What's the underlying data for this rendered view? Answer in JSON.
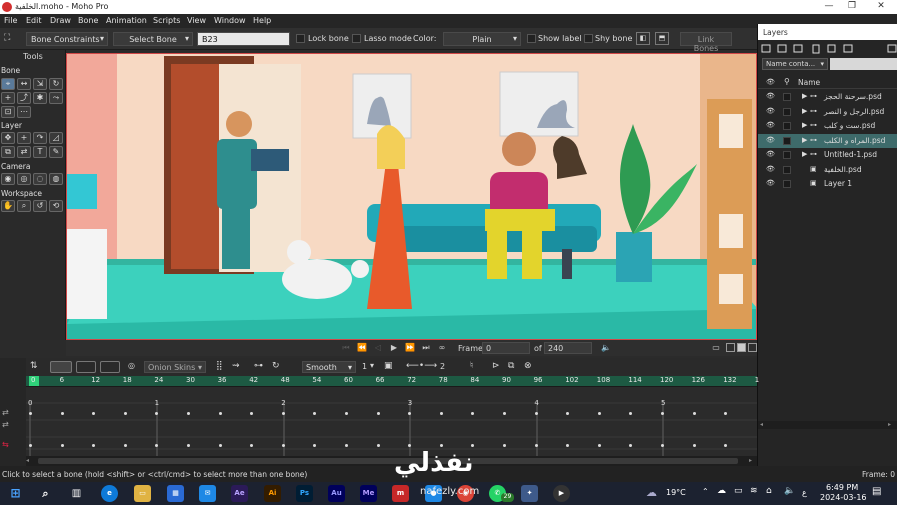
{
  "window": {
    "title": "الخلفية.moho - Moho Pro",
    "min": "—",
    "max": "❐",
    "close": "✕"
  },
  "menu": [
    "File",
    "Edit",
    "Draw",
    "Bone",
    "Animation",
    "Scripts",
    "View",
    "Window",
    "Help"
  ],
  "toolbar": {
    "bone_constraints": "Bone Constraints",
    "select_bone": "Select Bone",
    "bone_name_value": "B23",
    "lock_bone": "Lock bone",
    "lasso_mode": "Lasso mode",
    "color_label": "Color:",
    "color_value": "Plain",
    "show_label": "Show label",
    "shy_bone": "Shy bone",
    "link_bones": "Link Bones"
  },
  "tools_panel": {
    "header": "Tools",
    "sections": {
      "bone": "Bone",
      "layer": "Layer",
      "camera": "Camera",
      "workspace": "Workspace"
    }
  },
  "playback": {
    "frame_label": "Frame",
    "frame_value": "0",
    "of_label": "of",
    "total_frames": "240"
  },
  "timeline": {
    "onion_skins": "Onion Skins",
    "interp": "Smooth",
    "interp_num": "1",
    "count": "2",
    "ruler_ticks": [
      "0",
      "6",
      "12",
      "18",
      "24",
      "30",
      "36",
      "42",
      "48",
      "54",
      "60",
      "66",
      "72",
      "78",
      "84",
      "90",
      "96",
      "102",
      "108",
      "114",
      "120",
      "126",
      "132",
      "1"
    ],
    "sub_markers": [
      "0",
      "1",
      "2",
      "3",
      "4",
      "5"
    ]
  },
  "layers_panel": {
    "title": "Layers",
    "filter_label": "Name conta...",
    "name_header": "Name",
    "layers": [
      {
        "name": "سرحنة الحجز.psd",
        "selected": false,
        "folder": true
      },
      {
        "name": "الرجل و النصر.psd",
        "selected": false,
        "folder": true
      },
      {
        "name": "ست و كلب.psd",
        "selected": false,
        "folder": true
      },
      {
        "name": "المراه و الكلب.psd",
        "selected": true,
        "folder": true
      },
      {
        "name": "Untitled-1.psd",
        "selected": false,
        "folder": true
      },
      {
        "name": "الخلفية.psd",
        "selected": false,
        "folder": false
      },
      {
        "name": "Layer 1",
        "selected": false,
        "folder": false
      }
    ]
  },
  "status": {
    "hint": "Click to select a bone (hold <shift> or <ctrl/cmd> to select more than one bone)",
    "frame": "Frame: 0"
  },
  "taskbar": {
    "weather": "19°C",
    "time": "6:49 PM",
    "date": "2024-03-16",
    "lang": "ع",
    "watermark": "نفذلي",
    "watermark_url": "nafezly.com",
    "badge": "29"
  },
  "colors": {
    "accent_green": "#1d5a43",
    "selected_layer": "#3e6b6b",
    "canvas_border": "#d04848"
  }
}
